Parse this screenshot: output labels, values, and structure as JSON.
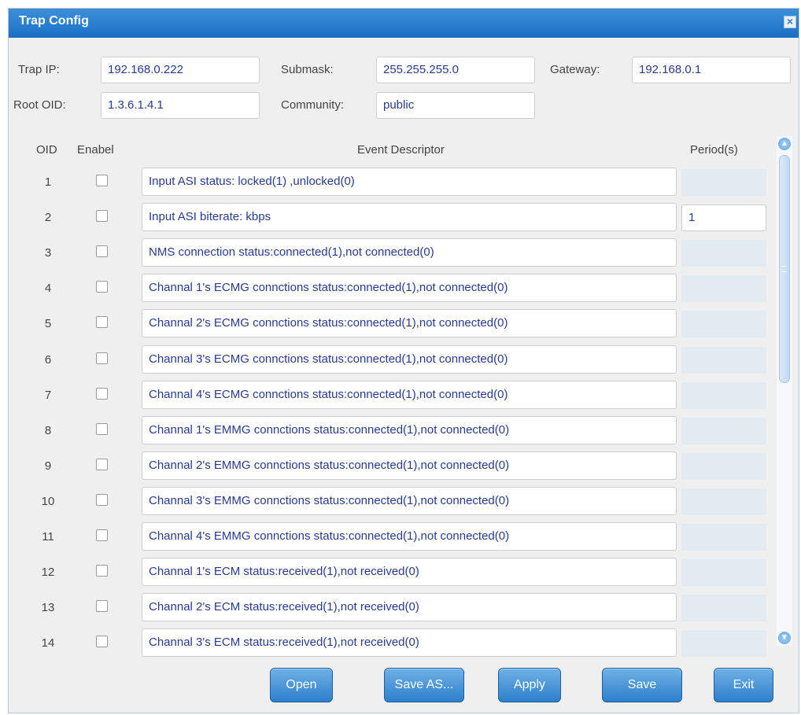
{
  "window": {
    "title": "Trap Config",
    "close_glyph": "×"
  },
  "config": {
    "trap_ip_label": "Trap IP:",
    "trap_ip": "192.168.0.222",
    "submask_label": "Submask:",
    "submask": "255.255.255.0",
    "gateway_label": "Gateway:",
    "gateway": "192.168.0.1",
    "root_oid_label": "Root OID:",
    "root_oid": "1.3.6.1.4.1",
    "community_label": "Community:",
    "community": "public"
  },
  "table": {
    "headers": {
      "oid": "OID",
      "enable": "Enabel",
      "descriptor": "Event Descriptor",
      "period": "Period(s)"
    },
    "rows": [
      {
        "oid": "1",
        "enabled": false,
        "descriptor": "Input ASI status: locked(1) ,unlocked(0)",
        "period": ""
      },
      {
        "oid": "2",
        "enabled": false,
        "descriptor": "Input ASI biterate:  kbps",
        "period": "1"
      },
      {
        "oid": "3",
        "enabled": false,
        "descriptor": "NMS connection status:connected(1),not connected(0)",
        "period": ""
      },
      {
        "oid": "4",
        "enabled": false,
        "descriptor": "Channal 1's ECMG connctions status:connected(1),not connected(0)",
        "period": ""
      },
      {
        "oid": "5",
        "enabled": false,
        "descriptor": "Channal 2's ECMG connctions status:connected(1),not connected(0)",
        "period": ""
      },
      {
        "oid": "6",
        "enabled": false,
        "descriptor": "Channal 3's ECMG connctions status:connected(1),not connected(0)",
        "period": ""
      },
      {
        "oid": "7",
        "enabled": false,
        "descriptor": "Channal 4's ECMG connctions status:connected(1),not connected(0)",
        "period": ""
      },
      {
        "oid": "8",
        "enabled": false,
        "descriptor": "Channal 1's EMMG connctions status:connected(1),not connected(0)",
        "period": ""
      },
      {
        "oid": "9",
        "enabled": false,
        "descriptor": "Channal 2's EMMG connctions status:connected(1),not connected(0)",
        "period": ""
      },
      {
        "oid": "10",
        "enabled": false,
        "descriptor": "Channal 3's EMMG connctions status:connected(1),not connected(0)",
        "period": ""
      },
      {
        "oid": "11",
        "enabled": false,
        "descriptor": "Channal 4's EMMG connctions status:connected(1),not connected(0)",
        "period": ""
      },
      {
        "oid": "12",
        "enabled": false,
        "descriptor": "Channal 1's ECM status:received(1),not received(0)",
        "period": ""
      },
      {
        "oid": "13",
        "enabled": false,
        "descriptor": "Channal 2's ECM status:received(1),not received(0)",
        "period": ""
      },
      {
        "oid": "14",
        "enabled": false,
        "descriptor": "Channal 3's ECM status:received(1),not received(0)",
        "period": ""
      }
    ]
  },
  "buttons": {
    "open": "Open",
    "save_as": "Save AS...",
    "apply": "Apply",
    "save": "Save",
    "exit": "Exit"
  },
  "icons": {
    "close": "close-icon",
    "scroll_up": "chevron-up-icon",
    "scroll_down": "chevron-down-icon"
  },
  "colors": {
    "titlebar": "#1b6fc4",
    "button": "#2d7fcb",
    "field_text": "#2a3b8f"
  }
}
